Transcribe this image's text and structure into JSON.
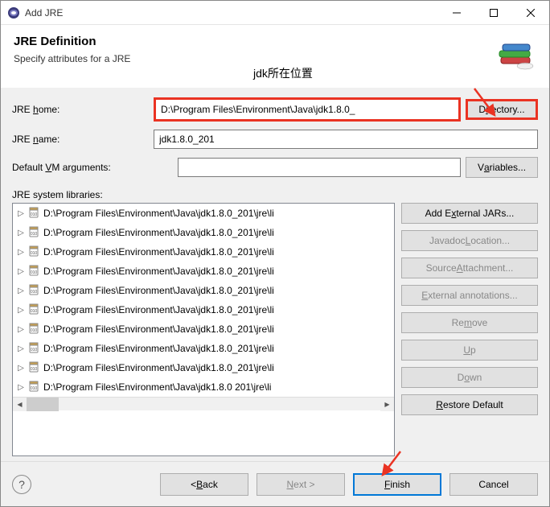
{
  "window": {
    "title": "Add JRE"
  },
  "header": {
    "title": "JRE Definition",
    "subtitle": "Specify attributes for a JRE",
    "annotation": "jdk所在位置"
  },
  "form": {
    "jre_home_label": "JRE home:",
    "jre_home_value": "D:\\Program Files\\Environment\\Java\\jdk1.8.0_",
    "jre_name_label": "JRE name:",
    "jre_name_value": "jdk1.8.0_201",
    "vm_args_label": "Default VM arguments:",
    "vm_args_value": "",
    "directory_btn": "Directory...",
    "variables_btn": "Variables..."
  },
  "libs": {
    "label": "JRE system libraries:",
    "items": [
      "D:\\Program Files\\Environment\\Java\\jdk1.8.0_201\\jre\\li",
      "D:\\Program Files\\Environment\\Java\\jdk1.8.0_201\\jre\\li",
      "D:\\Program Files\\Environment\\Java\\jdk1.8.0_201\\jre\\li",
      "D:\\Program Files\\Environment\\Java\\jdk1.8.0_201\\jre\\li",
      "D:\\Program Files\\Environment\\Java\\jdk1.8.0_201\\jre\\li",
      "D:\\Program Files\\Environment\\Java\\jdk1.8.0_201\\jre\\li",
      "D:\\Program Files\\Environment\\Java\\jdk1.8.0_201\\jre\\li",
      "D:\\Program Files\\Environment\\Java\\jdk1.8.0_201\\jre\\li",
      "D:\\Program Files\\Environment\\Java\\jdk1.8.0_201\\jre\\li",
      "D:\\Program Files\\Environment\\Java\\jdk1.8.0 201\\jre\\li"
    ],
    "buttons": {
      "add_external": "Add External JARs...",
      "javadoc": "Javadoc Location...",
      "source": "Source Attachment...",
      "ext_annot": "External annotations...",
      "remove": "Remove",
      "up": "Up",
      "down": "Down",
      "restore": "Restore Default"
    }
  },
  "footer": {
    "back": "< Back",
    "next": "Next >",
    "finish": "Finish",
    "cancel": "Cancel"
  }
}
